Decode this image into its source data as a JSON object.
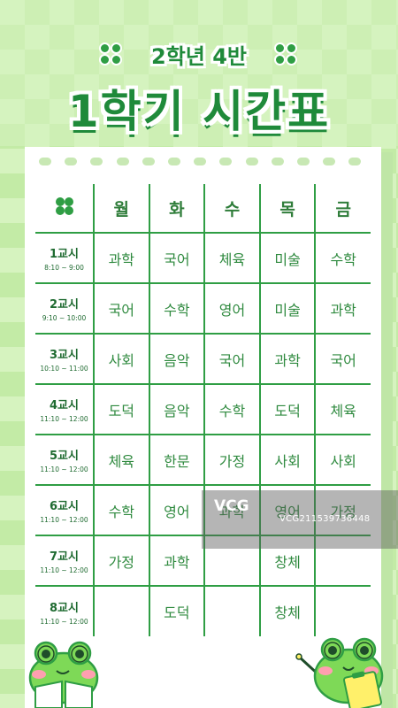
{
  "header": {
    "subtitle": "2학년 4반",
    "title": "1학기 시간표"
  },
  "timetable": {
    "days": [
      "월",
      "화",
      "수",
      "목",
      "금"
    ],
    "rows": [
      {
        "period": "1교시",
        "time": "8:10 ~ 9:00",
        "subjects": [
          "과학",
          "국어",
          "체육",
          "미술",
          "수학"
        ]
      },
      {
        "period": "2교시",
        "time": "9:10 ~ 10:00",
        "subjects": [
          "국어",
          "수학",
          "영어",
          "미술",
          "과학"
        ]
      },
      {
        "period": "3교시",
        "time": "10:10 ~ 11:00",
        "subjects": [
          "사회",
          "음악",
          "국어",
          "과학",
          "국어"
        ]
      },
      {
        "period": "4교시",
        "time": "11:10 ~ 12:00",
        "subjects": [
          "도덕",
          "음악",
          "수학",
          "도덕",
          "체육"
        ]
      },
      {
        "period": "5교시",
        "time": "11:10 ~ 12:00",
        "subjects": [
          "체육",
          "한문",
          "가정",
          "사회",
          "사회"
        ]
      },
      {
        "period": "6교시",
        "time": "11:10 ~ 12:00",
        "subjects": [
          "수학",
          "영어",
          "과학",
          "영어",
          "가정"
        ]
      },
      {
        "period": "7교시",
        "time": "11:10 ~ 12:00",
        "subjects": [
          "가정",
          "과학",
          "",
          "창체",
          ""
        ]
      },
      {
        "period": "8교시",
        "time": "11:10 ~ 12:00",
        "subjects": [
          "",
          "도덕",
          "",
          "창체",
          ""
        ]
      }
    ]
  },
  "watermark": {
    "logo": "VCG",
    "text": "VCG211539736448"
  },
  "colors": {
    "accent": "#2f9e44",
    "background": "#d6f3bf",
    "paper": "#ffffff"
  }
}
